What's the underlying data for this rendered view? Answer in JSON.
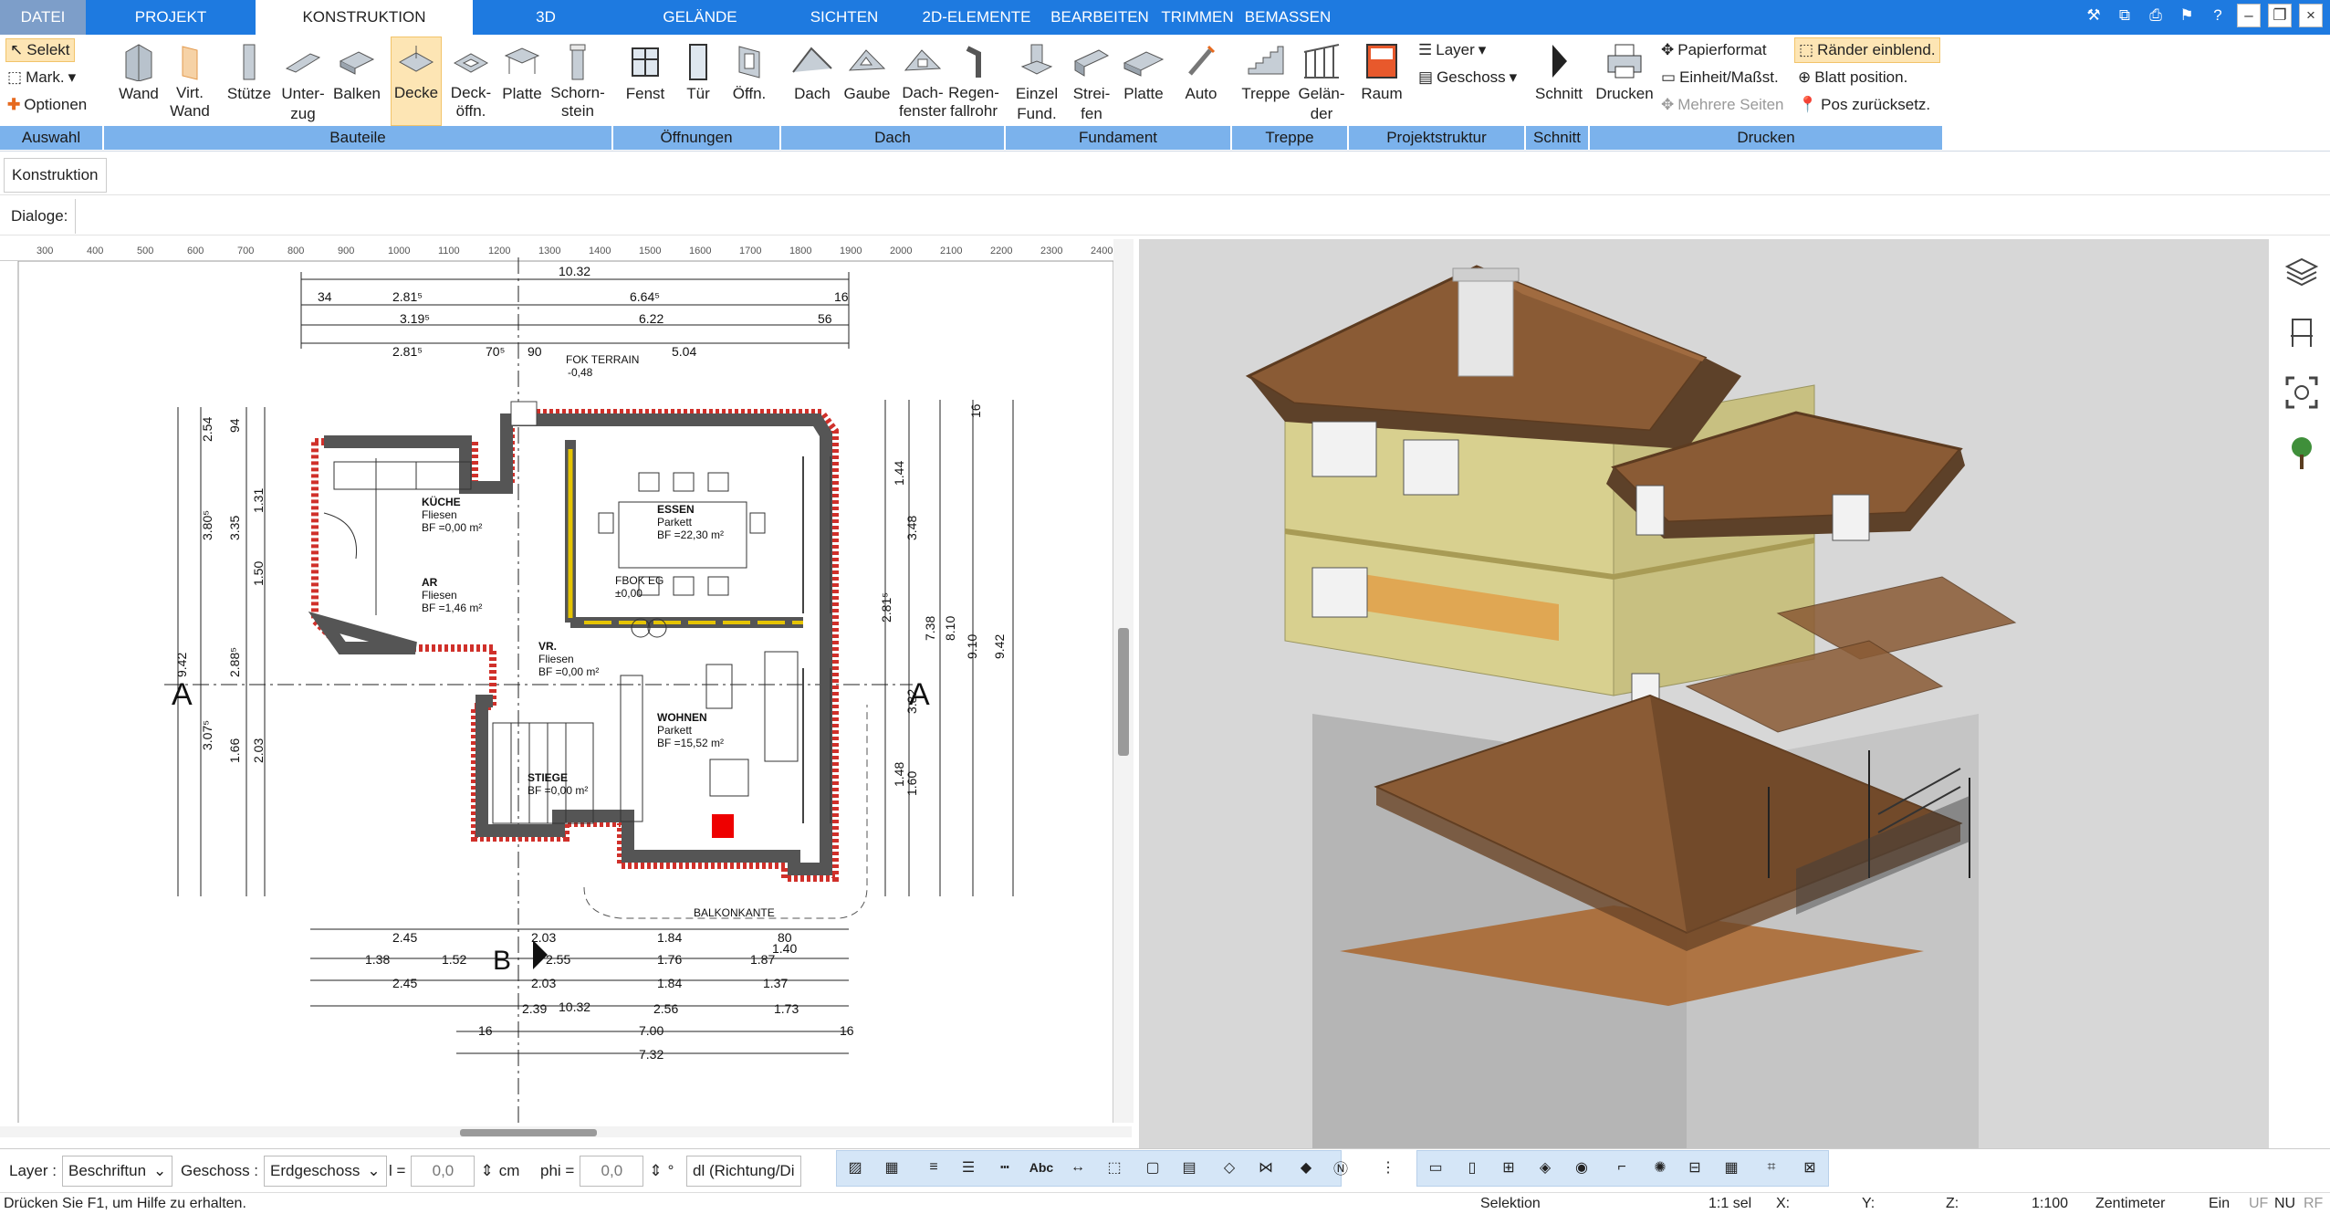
{
  "menu": {
    "tabs": [
      "DATEI",
      "PROJEKT",
      "KONSTRUKTION",
      "3D",
      "GELÄNDE",
      "SICHTEN",
      "2D-ELEMENTE",
      "BEARBEITEN",
      "TRIMMEN",
      "BEMASSEN"
    ],
    "active": "KONSTRUKTION"
  },
  "ribbon": {
    "auswahl": {
      "selekt": "Selekt",
      "mark": "Mark.",
      "optionen": "Optionen"
    },
    "bauteile": [
      "Wand",
      "Virt. Wand",
      "Stütze",
      "Unter-zug",
      "Balken",
      "Decke",
      "Deck-öffn.",
      "Platte",
      "Schorn-stein"
    ],
    "oeffnungen": [
      "Fenst",
      "Tür",
      "Öffn."
    ],
    "dach": [
      "Dach",
      "Gaube",
      "Dach-fenster",
      "Regen-fallrohr"
    ],
    "fundament": [
      "Einzel Fund.",
      "Strei-fen",
      "Platte"
    ],
    "auto": "Auto",
    "treppe": [
      "Treppe",
      "Gelän-der"
    ],
    "raum": "Raum",
    "layer": "Layer",
    "geschoss": "Geschoss",
    "schnitt": "Schnitt",
    "drucken": "Drucken",
    "papierformat": "Papierformat",
    "einheit": "Einheit/Maßst.",
    "mehrere": "Mehrere Seiten",
    "raender": "Ränder einblend.",
    "blatt": "Blatt position.",
    "pos": "Pos zurücksetz.",
    "groups": [
      "Auswahl",
      "Bauteile",
      "Öffnungen",
      "Dach",
      "Fundament",
      "Treppe",
      "Projektstruktur",
      "Schnitt",
      "Drucken"
    ]
  },
  "panel": {
    "title": "Konstruktion",
    "dialoge": "Dialoge:"
  },
  "plan": {
    "ruler_x": [
      "300",
      "400",
      "500",
      "600",
      "700",
      "800",
      "900",
      "1000",
      "1100",
      "1200",
      "1300",
      "1400",
      "1500",
      "1600",
      "1700",
      "1800",
      "1900",
      "2000",
      "2100",
      "2200",
      "2300",
      "2400"
    ],
    "dims_top": [
      "10.32",
      "2.81⁵",
      "6.64⁵",
      "3.19⁵",
      "6.22",
      "2.81⁵",
      "70⁵",
      "90",
      "5.04",
      "34",
      "56",
      "16"
    ],
    "rooms": [
      {
        "name": "KÜCHE",
        "floor": "Fliesen",
        "area": "BF =0,00 m²"
      },
      {
        "name": "ESSEN",
        "floor": "Parkett",
        "area": "BF =22,30 m²"
      },
      {
        "name": "AR",
        "floor": "Fliesen",
        "area": "BF =1,46 m²"
      },
      {
        "name": "VR.",
        "floor": "Fliesen",
        "area": "BF =0,00 m²"
      },
      {
        "name": "WOHNEN",
        "floor": "Parkett",
        "area": "BF =15,52 m²"
      },
      {
        "name": "STIEGE",
        "floor": "",
        "area": "BF =0,00 m²"
      }
    ],
    "labels": {
      "fok_terrain": "FOK TERRAIN",
      "fok_terrain_val": "-0,48",
      "fbok": "FBOK EG",
      "fbok_val": "±0,00",
      "balkon": "BALKONKANTE",
      "section_a": "A",
      "section_b": "B"
    },
    "dims_bottom": [
      "2.45",
      "2.03",
      "1.84",
      "1.38",
      "1.52",
      "2.55",
      "1.76",
      "1.87",
      "1.40",
      "80",
      "1.37",
      "2.39",
      "10.32",
      "2.56",
      "1.73",
      "7.00",
      "7.32",
      "16"
    ],
    "dims_left": [
      "2.54",
      "94",
      "1.31",
      "3.80⁵",
      "3.35",
      "1.50",
      "9.42",
      "2.88⁵",
      "3.07⁵",
      "1.66",
      "2.03"
    ],
    "dims_right": [
      "1.44",
      "3.48",
      "7.38",
      "8.10",
      "9.10",
      "9.42",
      "2.81⁵",
      "3.82",
      "1.48",
      "1.60",
      "16"
    ]
  },
  "bottom": {
    "layer_label": "Layer :",
    "layer_value": "Beschriftun",
    "geschoss_label": "Geschoss :",
    "geschoss_value": "Erdgeschoss",
    "l_label": "l =",
    "l_value": "0,0",
    "unit": "cm",
    "phi_label": "phi =",
    "phi_value": "0,0",
    "deg": "°",
    "dl": "dl (Richtung/Di"
  },
  "status": {
    "help": "Drücken Sie F1, um Hilfe zu erhalten.",
    "mode": "Selektion",
    "sel": "1:1 sel",
    "x": "X:",
    "y": "Y:",
    "z": "Z:",
    "scale": "1:100",
    "unit": "Zentimeter",
    "ein": "Ein",
    "uf": "UF",
    "nu": "NU",
    "rf": "RF"
  }
}
